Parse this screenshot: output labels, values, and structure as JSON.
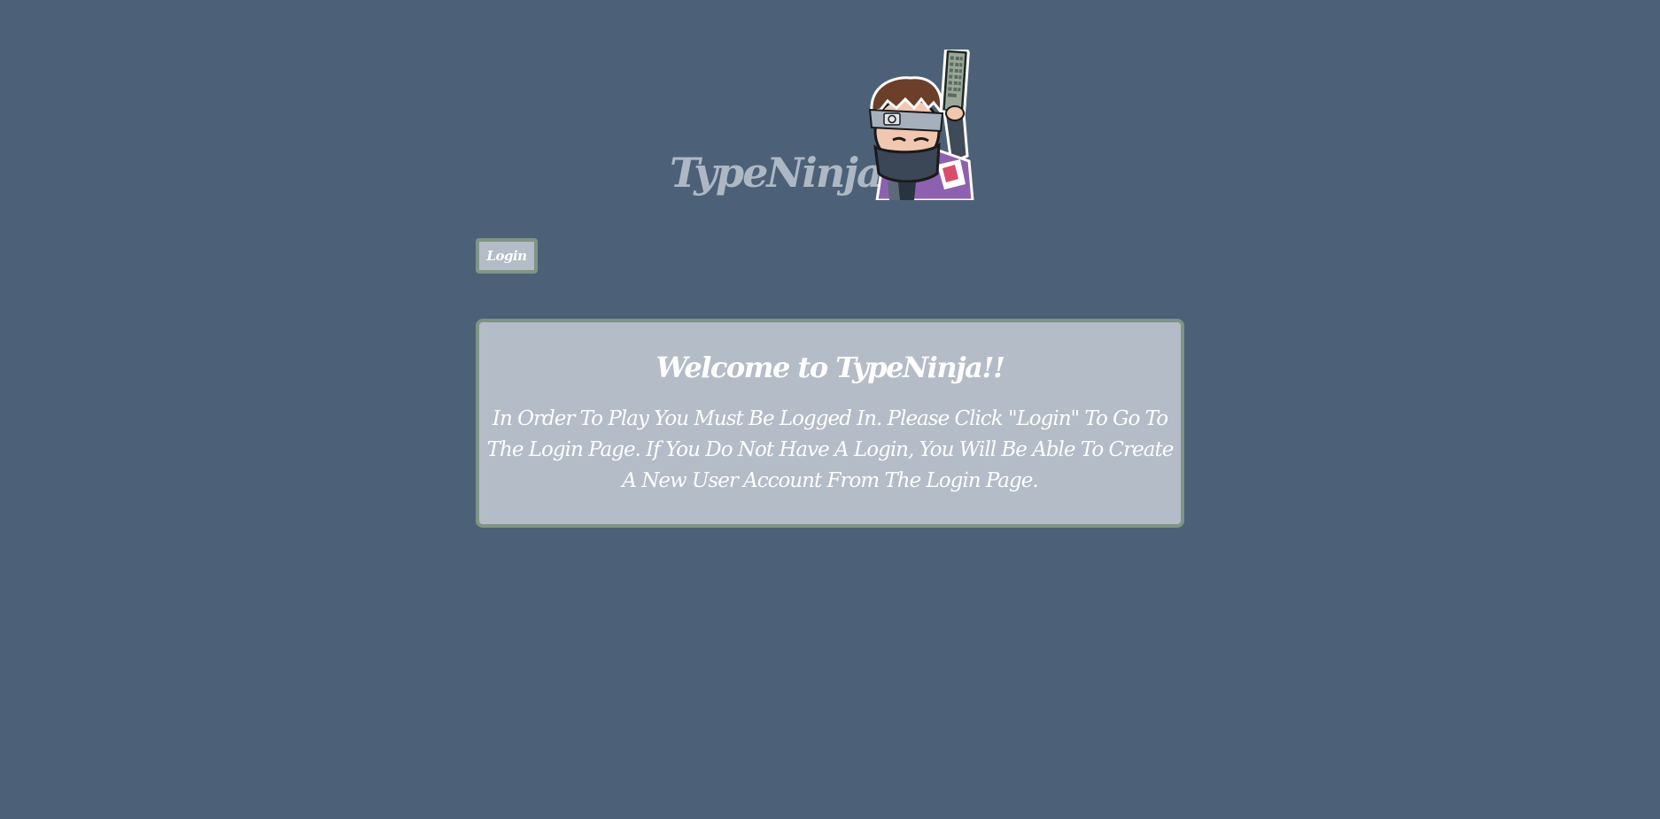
{
  "header": {
    "title": "TypeNinja",
    "mascot_icon": "ninja-mascot-with-keyboard"
  },
  "nav": {
    "login_label": "Login"
  },
  "welcome": {
    "title": "Welcome to TypeNinja!!",
    "message": "In Order To Play You Must Be Logged In. Please Click \"Login\" To Go To The Login Page. If You Do Not Have A Login, You Will Be Able To Create A New User Account From The Login Page."
  },
  "colors": {
    "background": "#4c6177",
    "panel": "#b3bcc7",
    "border": "#7f9585",
    "title_text": "#adb8c4",
    "text": "#ffffff"
  }
}
